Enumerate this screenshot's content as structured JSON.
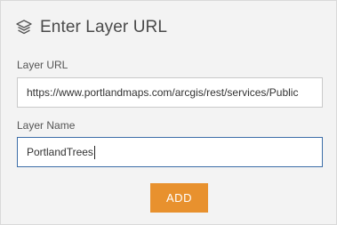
{
  "header": {
    "icon": "layers-icon",
    "title": "Enter Layer URL"
  },
  "form": {
    "url_label": "Layer URL",
    "url_value": "https://www.portlandmaps.com/arcgis/rest/services/Public",
    "name_label": "Layer Name",
    "name_value": "PortlandTrees"
  },
  "actions": {
    "add_label": "ADD"
  },
  "colors": {
    "accent": "#e8912e",
    "focus_border": "#3d6ea8",
    "background": "#f3f3f3"
  }
}
